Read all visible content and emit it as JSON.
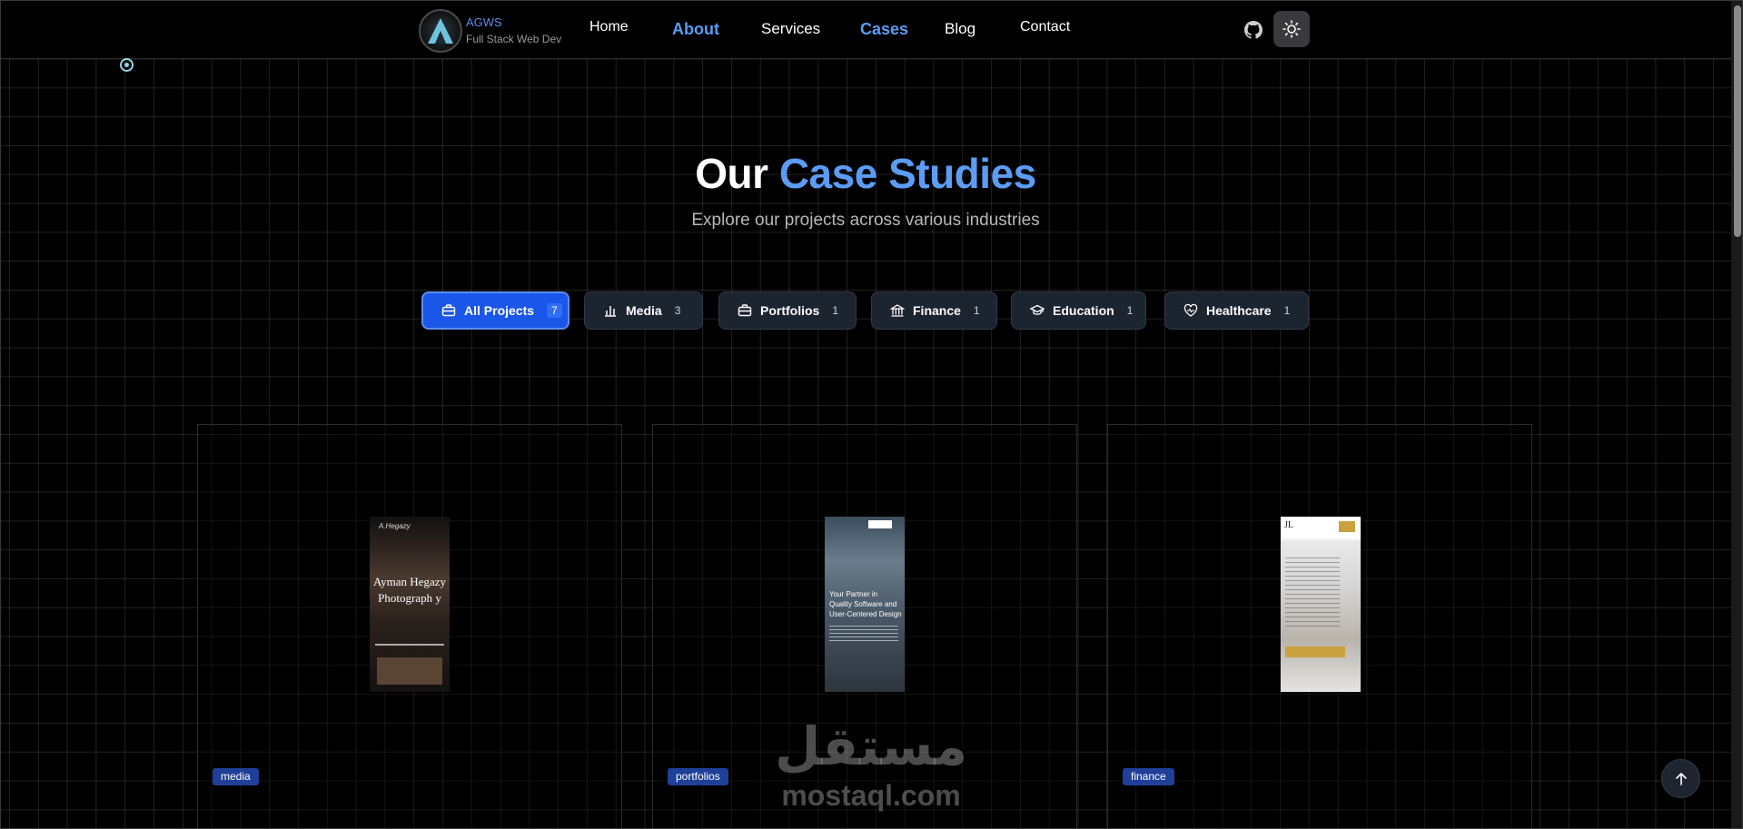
{
  "brand": {
    "name": "AGWS",
    "tagline": "Full Stack Web Dev"
  },
  "nav": [
    {
      "label": "Home",
      "active": false
    },
    {
      "label": "About",
      "active": true
    },
    {
      "label": "Services",
      "active": false
    },
    {
      "label": "Cases",
      "active": true
    },
    {
      "label": "Blog",
      "active": false
    },
    {
      "label": "Contact",
      "active": false
    }
  ],
  "header_icons": [
    "github-icon",
    "sun-icon"
  ],
  "hero": {
    "title_plain": "Our",
    "title_accent": "Case Studies",
    "subtitle": "Explore our projects across various industries"
  },
  "filters": [
    {
      "label": "All Projects",
      "count": "7",
      "icon": "briefcase-icon",
      "active": true
    },
    {
      "label": "Media",
      "count": "3",
      "icon": "bar-chart-icon",
      "active": false
    },
    {
      "label": "Portfolios",
      "count": "1",
      "icon": "briefcase-icon",
      "active": false
    },
    {
      "label": "Finance",
      "count": "1",
      "icon": "bank-icon",
      "active": false
    },
    {
      "label": "Education",
      "count": "1",
      "icon": "graduation-cap-icon",
      "active": false
    },
    {
      "label": "Healthcare",
      "count": "1",
      "icon": "heart-pulse-icon",
      "active": false
    }
  ],
  "cards": [
    {
      "tag": "media",
      "preview": {
        "heading": "Ayman Hegazy Photograph y"
      }
    },
    {
      "tag": "portfolios",
      "preview": {
        "heading": "Your Partner in Quality Software and User-Centered Design"
      }
    },
    {
      "tag": "finance",
      "preview": {
        "logo": "JL"
      }
    }
  ],
  "watermark": {
    "arabic": "مستقل",
    "latin": "mostaql.com"
  },
  "colors": {
    "accent": "#5b9cf5",
    "active_filter": "#1a56e8",
    "tag_bg": "#1f3f98",
    "background": "#000000"
  }
}
